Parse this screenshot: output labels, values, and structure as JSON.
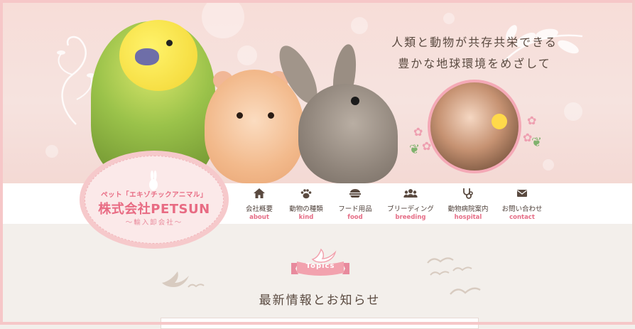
{
  "hero": {
    "tagline_line1": "人類と動物が共存共栄できる",
    "tagline_line2": "豊かな地球環境をめざして"
  },
  "logo": {
    "top": "ペット「エキゾチックアニマル」",
    "main": "株式会社PETSUN",
    "sub": "～輸入卸会社～"
  },
  "nav": {
    "items": [
      {
        "jp": "会社概要",
        "en": "about",
        "icon": "home-icon"
      },
      {
        "jp": "動物の種類",
        "en": "kind",
        "icon": "paw-icon"
      },
      {
        "jp": "フード用品",
        "en": "food",
        "icon": "food-bowl-icon"
      },
      {
        "jp": "ブリーディング",
        "en": "breeding",
        "icon": "group-icon"
      },
      {
        "jp": "動物病院案内",
        "en": "hospital",
        "icon": "stethoscope-icon"
      },
      {
        "jp": "お問い合わせ",
        "en": "contact",
        "icon": "mail-icon"
      }
    ]
  },
  "topics": {
    "ribbon_label": "Topics",
    "heading": "最新情報とお知らせ"
  },
  "colors": {
    "accent_pink": "#e86b83",
    "frame_pink": "#f6c7c8",
    "text_brown": "#5a4a40"
  }
}
